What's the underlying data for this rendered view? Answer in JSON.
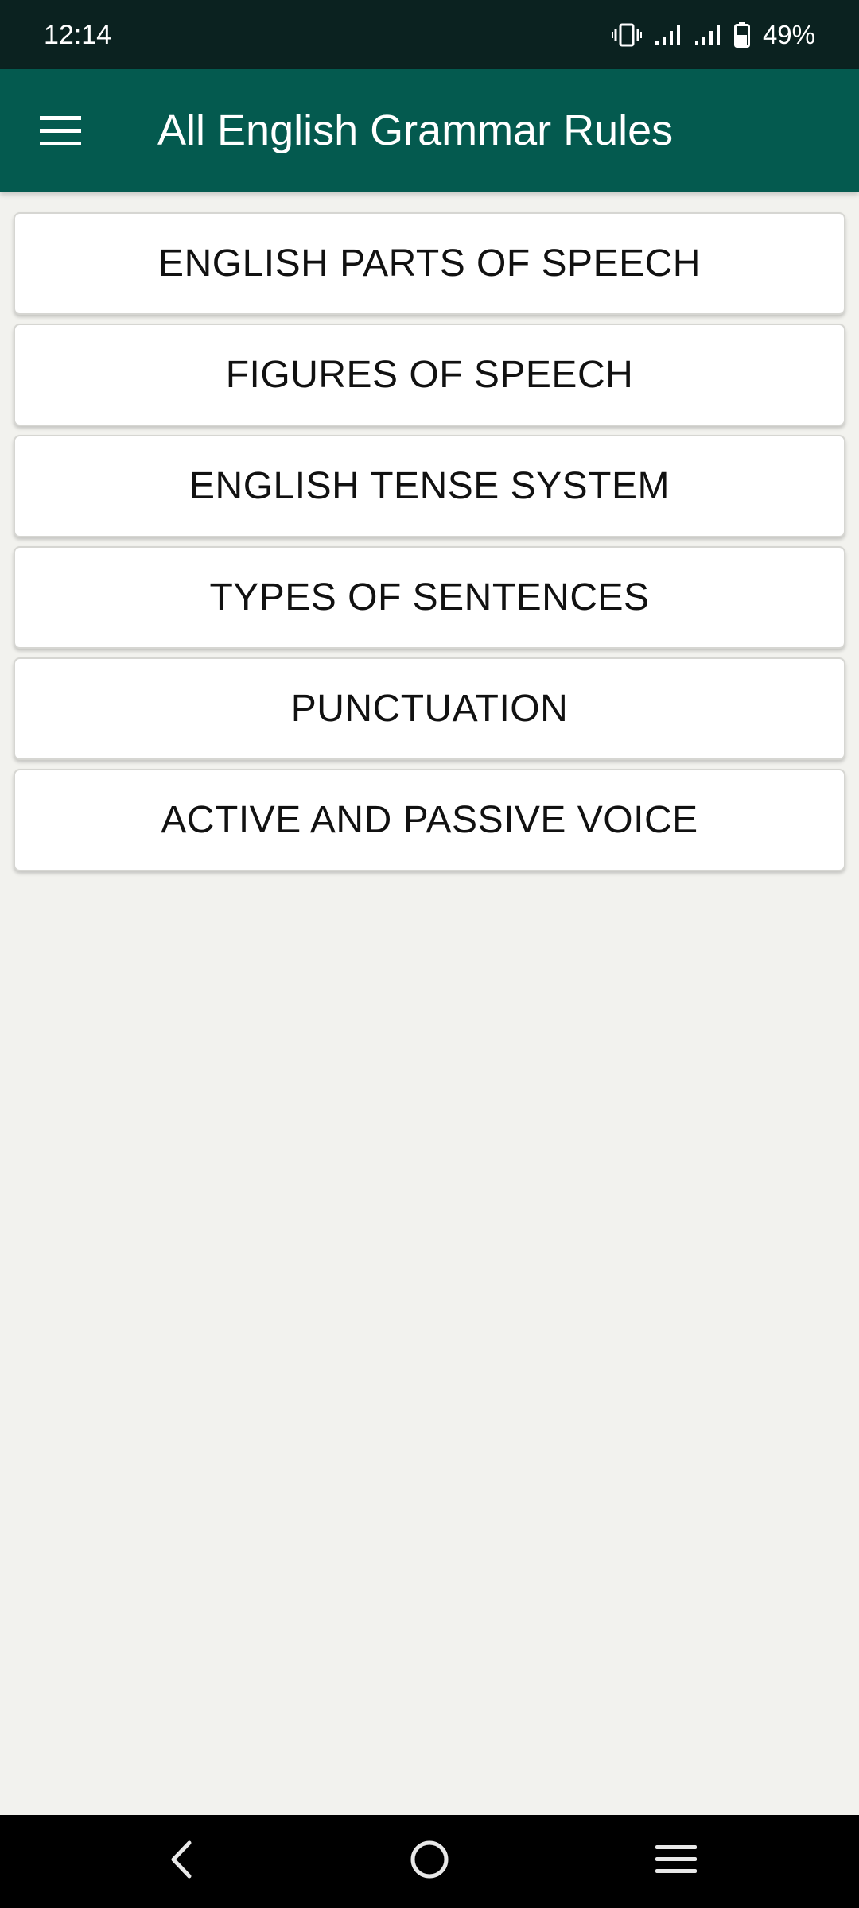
{
  "status_bar": {
    "time": "12:14",
    "battery_percent": "49%",
    "icons": [
      "vibrate-icon",
      "signal-icon",
      "signal-icon",
      "battery-icon"
    ]
  },
  "app_bar": {
    "title": "All English Grammar Rules",
    "menu_icon": "hamburger-menu-icon",
    "background_color": "#045a4f"
  },
  "menu": {
    "items": [
      {
        "label": "ENGLISH PARTS OF SPEECH"
      },
      {
        "label": "FIGURES OF SPEECH"
      },
      {
        "label": "ENGLISH TENSE SYSTEM"
      },
      {
        "label": "TYPES OF SENTENCES"
      },
      {
        "label": "PUNCTUATION"
      },
      {
        "label": "ACTIVE AND PASSIVE VOICE"
      }
    ]
  },
  "nav_bar": {
    "icons": [
      "back-icon",
      "home-icon",
      "recents-icon"
    ]
  }
}
